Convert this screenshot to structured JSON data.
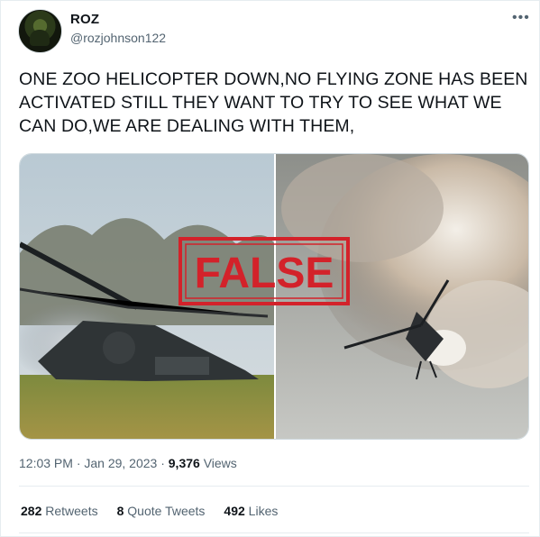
{
  "tweet": {
    "display_name": "ROZ",
    "handle": "@rozjohnson122",
    "more_icon": "more-horizontal-icon",
    "text": "ONE ZOO HELICOPTER DOWN,NO FLYING ZONE HAS BEEN ACTIVATED STILL THEY WANT TO TRY TO SEE WHAT WE CAN DO,WE ARE DEALING WITH THEM,",
    "media_label": "FALSE",
    "time": "12:03 PM · Jan 29, 2023 · ",
    "views_count": "9,376",
    "views_label": " Views"
  },
  "stats": {
    "retweets_count": "282",
    "retweets_label": " Retweets",
    "quote_count": "8",
    "quote_label": " Quote Tweets",
    "likes_count": "492",
    "likes_label": " Likes"
  },
  "colors": {
    "false_stamp": "#d3222a",
    "secondary_text": "#536471"
  }
}
